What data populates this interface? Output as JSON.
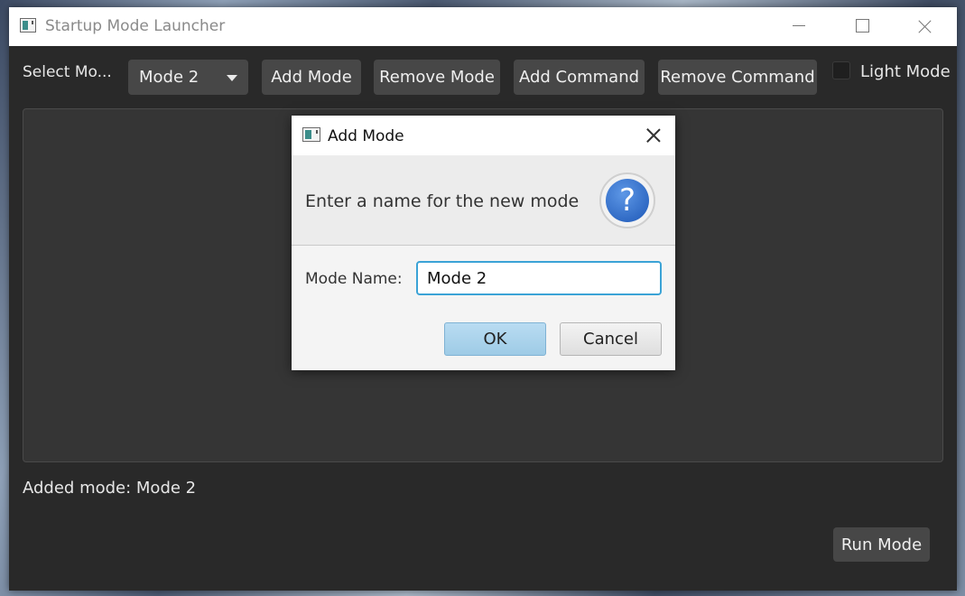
{
  "window": {
    "title": "Startup Mode Launcher"
  },
  "toolbar": {
    "select_label": "Select Mo...",
    "mode_select_value": "Mode 2",
    "add_mode": "Add Mode",
    "remove_mode": "Remove Mode",
    "add_command": "Add Command",
    "remove_command": "Remove Command",
    "light_mode_label": "Light Mode",
    "light_mode_checked": false
  },
  "status": {
    "text": "Added mode: Mode 2"
  },
  "run_button": "Run Mode",
  "dialog": {
    "title": "Add Mode",
    "header_text": "Enter a name for the new mode",
    "question_glyph": "?",
    "field_label": "Mode Name:",
    "field_value": "Mode 2",
    "ok": "OK",
    "cancel": "Cancel"
  },
  "colors": {
    "window_bg": "#292929",
    "button_bg": "#474747",
    "focus_border": "#3ba3d6",
    "question_icon": "#1d57b6"
  }
}
